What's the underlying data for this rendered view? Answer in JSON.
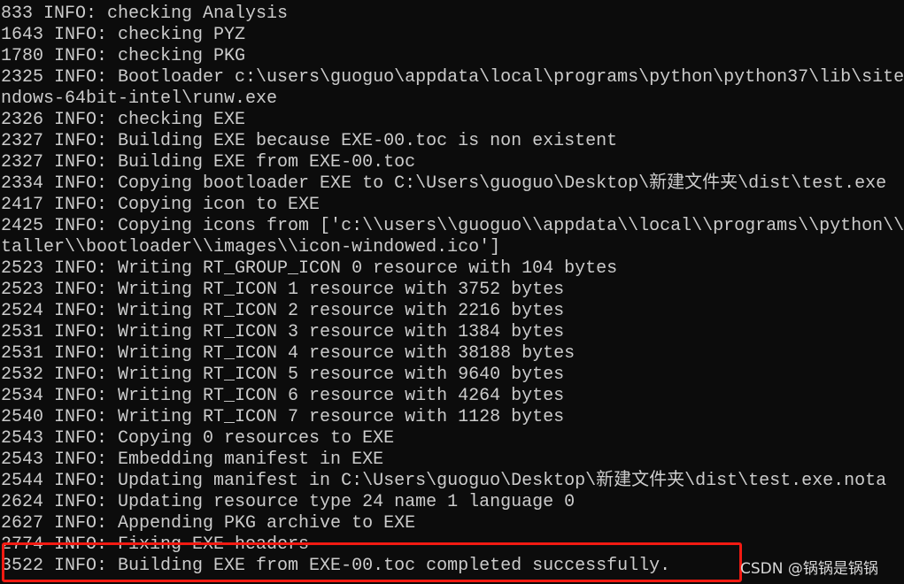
{
  "console": {
    "lines": [
      "833 INFO: checking Analysis",
      "1643 INFO: checking PYZ",
      "1780 INFO: checking PKG",
      "2325 INFO: Bootloader c:\\users\\guoguo\\appdata\\local\\programs\\python\\python37\\lib\\site",
      "ndows-64bit-intel\\runw.exe",
      "2326 INFO: checking EXE",
      "2327 INFO: Building EXE because EXE-00.toc is non existent",
      "2327 INFO: Building EXE from EXE-00.toc",
      "2334 INFO: Copying bootloader EXE to C:\\Users\\guoguo\\Desktop\\新建文件夹\\dist\\test.exe",
      "2417 INFO: Copying icon to EXE",
      "2425 INFO: Copying icons from ['c:\\\\users\\\\guoguo\\\\appdata\\\\local\\\\programs\\\\python\\\\",
      "taller\\\\bootloader\\\\images\\\\icon-windowed.ico']",
      "2523 INFO: Writing RT_GROUP_ICON 0 resource with 104 bytes",
      "2523 INFO: Writing RT_ICON 1 resource with 3752 bytes",
      "2524 INFO: Writing RT_ICON 2 resource with 2216 bytes",
      "2531 INFO: Writing RT_ICON 3 resource with 1384 bytes",
      "2531 INFO: Writing RT_ICON 4 resource with 38188 bytes",
      "2532 INFO: Writing RT_ICON 5 resource with 9640 bytes",
      "2534 INFO: Writing RT_ICON 6 resource with 4264 bytes",
      "2540 INFO: Writing RT_ICON 7 resource with 1128 bytes",
      "2543 INFO: Copying 0 resources to EXE",
      "2543 INFO: Embedding manifest in EXE",
      "2544 INFO: Updating manifest in C:\\Users\\guoguo\\Desktop\\新建文件夹\\dist\\test.exe.nota",
      "2624 INFO: Updating resource type 24 name 1 language 0",
      "2627 INFO: Appending PKG archive to EXE",
      "2774 INFO: Fixing EXE headers",
      "3522 INFO: Building EXE from EXE-00.toc completed successfully."
    ]
  },
  "watermark": "CSDN @锅锅是锅锅",
  "colors": {
    "background": "#0c0c0c",
    "text": "#cccccc",
    "highlight": "#f21a12"
  }
}
